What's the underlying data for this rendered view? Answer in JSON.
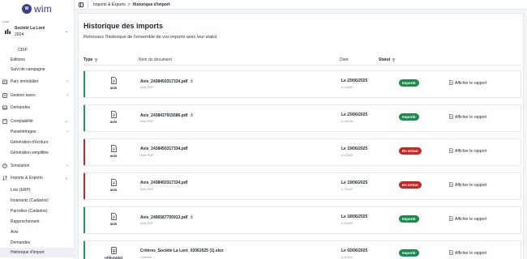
{
  "brand": {
    "logo_mark": "W",
    "logo_text": "wim"
  },
  "sidebar": {
    "section_label": "Loré",
    "company": {
      "name": "Société La Loré",
      "year": "2024"
    },
    "items": [
      {
        "label": "CDIF",
        "icon": "none",
        "chevron": ""
      },
      {
        "label": "Editions",
        "icon": "none",
        "chevron": ""
      },
      {
        "label": "Suivi de campagne",
        "icon": "none",
        "chevron": ""
      },
      {
        "label": "Parc immobilier",
        "icon": "building-icon",
        "chevron": "›"
      },
      {
        "label": "Gestion taxes",
        "icon": "tax-icon",
        "chevron": "›"
      },
      {
        "label": "Demandes",
        "icon": "inbox-icon",
        "chevron": ""
      },
      {
        "label": "Comptabilité",
        "icon": "accounting-icon",
        "chevron": "⌄"
      },
      {
        "label": "Paramétrages",
        "icon": "none",
        "chevron": "›"
      },
      {
        "label": "Génération d'écriture",
        "icon": "none",
        "chevron": ""
      },
      {
        "label": "Génération simplifiée",
        "icon": "none",
        "chevron": ""
      },
      {
        "label": "Simulation",
        "icon": "simulation-icon",
        "chevron": "›"
      },
      {
        "label": "Imports & Exports",
        "icon": "import-export-icon",
        "chevron": "⌄"
      },
      {
        "label": "Lots (ERP)",
        "icon": "none",
        "chevron": ""
      },
      {
        "label": "Invariants (Cadastre)",
        "icon": "none",
        "chevron": ""
      },
      {
        "label": "Parcelles (Cadastre)",
        "icon": "none",
        "chevron": ""
      },
      {
        "label": "Rapprochement",
        "icon": "none",
        "chevron": ""
      },
      {
        "label": "Avis",
        "icon": "none",
        "chevron": ""
      },
      {
        "label": "Demandes",
        "icon": "none",
        "chevron": ""
      },
      {
        "label": "Historique d'import",
        "icon": "none",
        "chevron": ""
      }
    ]
  },
  "breadcrumb": {
    "parent": "Imports & Exports",
    "separator": ">",
    "current": "Historique d'import"
  },
  "page": {
    "title": "Historique des imports",
    "subtitle": "Retrouvez l'historique de l'ensemble de vos imports avec leur statut"
  },
  "table": {
    "columns": {
      "type": "Type",
      "name": "Nom du document",
      "date": "Date",
      "status": "Statut"
    },
    "report_label": "Afficher le rapport",
    "rows": [
      {
        "type": "avis",
        "name": "Avis_2438450317334.pdf",
        "download": true,
        "ftype": "Avis PDF",
        "date": "Le 23/06/2025",
        "time": "à 14h22",
        "status": "Importé",
        "status_kind": "ok"
      },
      {
        "type": "avis",
        "name": "Avis_2438437915586.pdf",
        "download": true,
        "ftype": "Avis PDF",
        "date": "Le 23/06/2025",
        "time": "à 14h16",
        "status": "Importé",
        "status_kind": "ok"
      },
      {
        "type": "avis",
        "name": "Avis_2438450317334.pdf",
        "download": false,
        "ftype": "Avis PDF",
        "date": "Le 19/06/2025",
        "time": "à 13h59",
        "status": "En erreur",
        "status_kind": "ko"
      },
      {
        "type": "avis",
        "name": "Avis_2438450317334.pdf",
        "download": false,
        "ftype": "Avis PDF",
        "date": "Le 19/06/2025",
        "time": "à 13h47",
        "status": "En erreur",
        "status_kind": "ko"
      },
      {
        "type": "avis",
        "name": "Avis_2496587705913.pdf",
        "download": true,
        "ftype": "Avis PDF",
        "date": "Le 18/06/2025",
        "time": "à 09h06",
        "status": "Importé",
        "status_kind": "ok"
      },
      {
        "type": "référentiel",
        "name": "Critères_Société La Loré_02062025 (1).xlsx",
        "download": false,
        "ftype": "Critères",
        "date": "Le 02/06/2025",
        "time": "à 10h11",
        "status": "Importé",
        "status_kind": "ok"
      }
    ]
  }
}
